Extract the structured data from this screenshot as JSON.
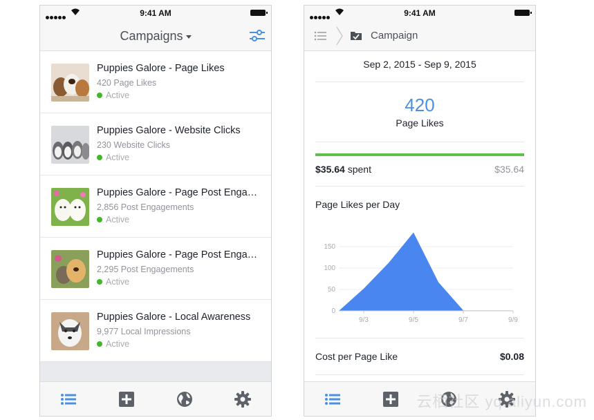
{
  "status_bar": {
    "time": "9:41 AM"
  },
  "campaigns_screen": {
    "title": "Campaigns",
    "campaigns": [
      {
        "name": "Puppies Galore - Page Likes",
        "result": "420 Page Likes",
        "status": "Active"
      },
      {
        "name": "Puppies Galore - Website Clicks",
        "result": "230 Website Clicks",
        "status": "Active"
      },
      {
        "name": "Puppies Galore - Page Post Engagement",
        "result": "2,856 Post Engagements",
        "status": "Active"
      },
      {
        "name": "Puppies Galore - Page Post Engagement",
        "result": "2,295 Post Engagements",
        "status": "Active"
      },
      {
        "name": "Puppies Galore - Local Awareness",
        "result": "9,977 Local Impressions",
        "status": "Active"
      }
    ]
  },
  "tab_bar": {
    "icons": [
      "list-icon",
      "add-icon",
      "globe-icon",
      "gear-icon"
    ]
  },
  "campaign_detail": {
    "breadcrumb_title": "Campaign",
    "date_range": "Sep 2, 2015 - Sep 9, 2015",
    "result_value": "420",
    "result_label": "Page Likes",
    "spent": "$35.64",
    "spent_suffix": " spent",
    "budget": "$35.64",
    "budget_progress": 1.0,
    "chart_title": "Page Likes per Day",
    "cost_label": "Cost per Page Like",
    "cost_value": "$0.08"
  },
  "chart_data": {
    "type": "area",
    "title": "Page Likes per Day",
    "x": [
      "9/2",
      "9/3",
      "9/4",
      "9/5",
      "9/6",
      "9/7",
      "9/8",
      "9/9"
    ],
    "x_tick_labels": [
      "9/3",
      "9/5",
      "9/7",
      "9/9"
    ],
    "series": [
      {
        "values": [
          0,
          52,
          112,
          183,
          67,
          1,
          1,
          1
        ]
      }
    ],
    "y_ticks": [
      0,
      50,
      100,
      150
    ],
    "ylim": [
      0,
      200
    ],
    "grid": true,
    "color": "#4a86f0"
  },
  "watermark": "云栖社区 yq.aliyun.com"
}
